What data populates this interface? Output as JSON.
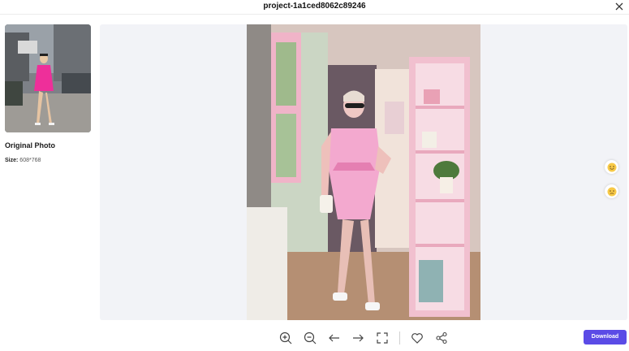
{
  "window": {
    "title": "project-1a1ced8062c89246"
  },
  "sidebar": {
    "original_label": "Original Photo",
    "size_label": "Size:",
    "size_value": "608*768"
  },
  "feedback": {
    "like": "smile-emoji-icon",
    "dislike": "neutral-emoji-icon"
  },
  "toolbar": {
    "icons": [
      "zoom-in-icon",
      "zoom-out-icon",
      "undo-arrow-icon",
      "redo-arrow-icon",
      "fit-screen-icon",
      "heart-icon",
      "share-icon"
    ],
    "download_label": "Download"
  },
  "colors": {
    "accent": "#5b4be6",
    "canvas_bg": "#f2f3f7",
    "dress_pink": "#f3a9cf",
    "magenta": "#ee2f9a"
  }
}
